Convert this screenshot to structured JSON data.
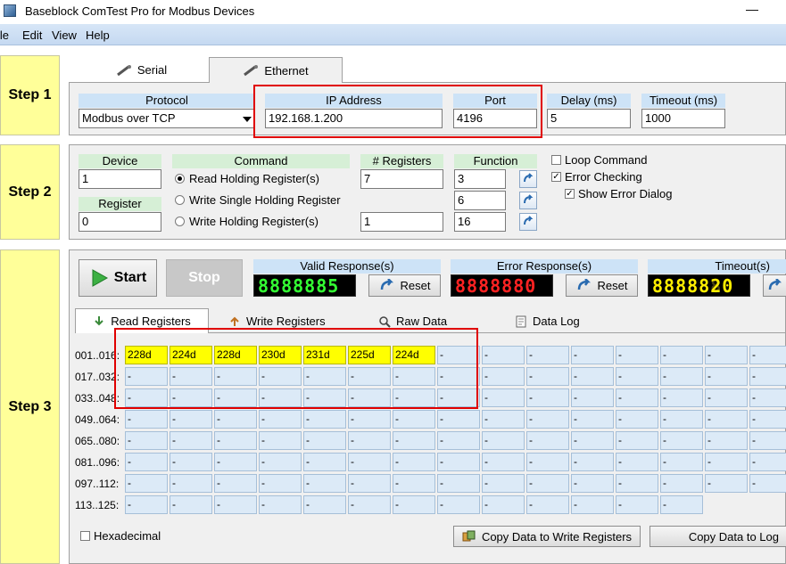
{
  "window": {
    "title": "Baseblock ComTest Pro for Modbus Devices",
    "min_glyph": "—"
  },
  "menu": {
    "file": "ile",
    "edit": "Edit",
    "view": "View",
    "help": "Help"
  },
  "steps": {
    "step1": "Step 1",
    "step2": "Step 2",
    "step3": "Step 3"
  },
  "step1": {
    "tabs": {
      "serial": "Serial",
      "ethernet": "Ethernet"
    },
    "protocol": {
      "label": "Protocol",
      "value": "Modbus over TCP"
    },
    "ip": {
      "label": "IP Address",
      "value": "192.168.1.200"
    },
    "port": {
      "label": "Port",
      "value": "4196"
    },
    "delay": {
      "label": "Delay (ms)",
      "value": "5"
    },
    "timeout": {
      "label": "Timeout (ms)",
      "value": "1000"
    }
  },
  "step2": {
    "device": {
      "label": "Device",
      "value": "1"
    },
    "register": {
      "label": "Register",
      "value": "0"
    },
    "command": {
      "label": "Command",
      "read_holding": "Read Holding Register(s)",
      "write_single": "Write Single Holding Register",
      "write_holding": "Write Holding Register(s)"
    },
    "registers": {
      "label": "# Registers",
      "read_value": "7",
      "write_value": "1"
    },
    "function": {
      "label": "Function",
      "f1": "3",
      "f2": "6",
      "f3": "16"
    },
    "options": {
      "loop": "Loop Command",
      "error_checking": "Error Checking",
      "show_error": "Show Error Dialog"
    }
  },
  "step3": {
    "start": "Start",
    "stop": "Stop",
    "valid": {
      "label": "Valid Response(s)",
      "digits": "8888885",
      "reset": "Reset"
    },
    "error": {
      "label": "Error Response(s)",
      "digits": "8888880",
      "reset": "Reset"
    },
    "timeout": {
      "label": "Timeout(s)",
      "digits": "8888820"
    },
    "tabs": {
      "read": "Read Registers",
      "write": "Write Registers",
      "raw": "Raw Data",
      "log": "Data Log"
    },
    "rows": [
      "001..016:",
      "017..032:",
      "033..048:",
      "049..064:",
      "065..080:",
      "081..096:",
      "097..112:",
      "113..125:"
    ],
    "row1_values": [
      "228d",
      "224d",
      "228d",
      "230d",
      "231d",
      "225d",
      "224d"
    ],
    "empty": "-",
    "hexadecimal": "Hexadecimal",
    "copy_write": "Copy Data to Write Registers",
    "copy_log": "Copy Data to Log"
  },
  "colors": {
    "led_green": "#33ff33",
    "led_red": "#ff2222",
    "led_yellow": "#ffee00",
    "highlight": "#ffff00"
  }
}
